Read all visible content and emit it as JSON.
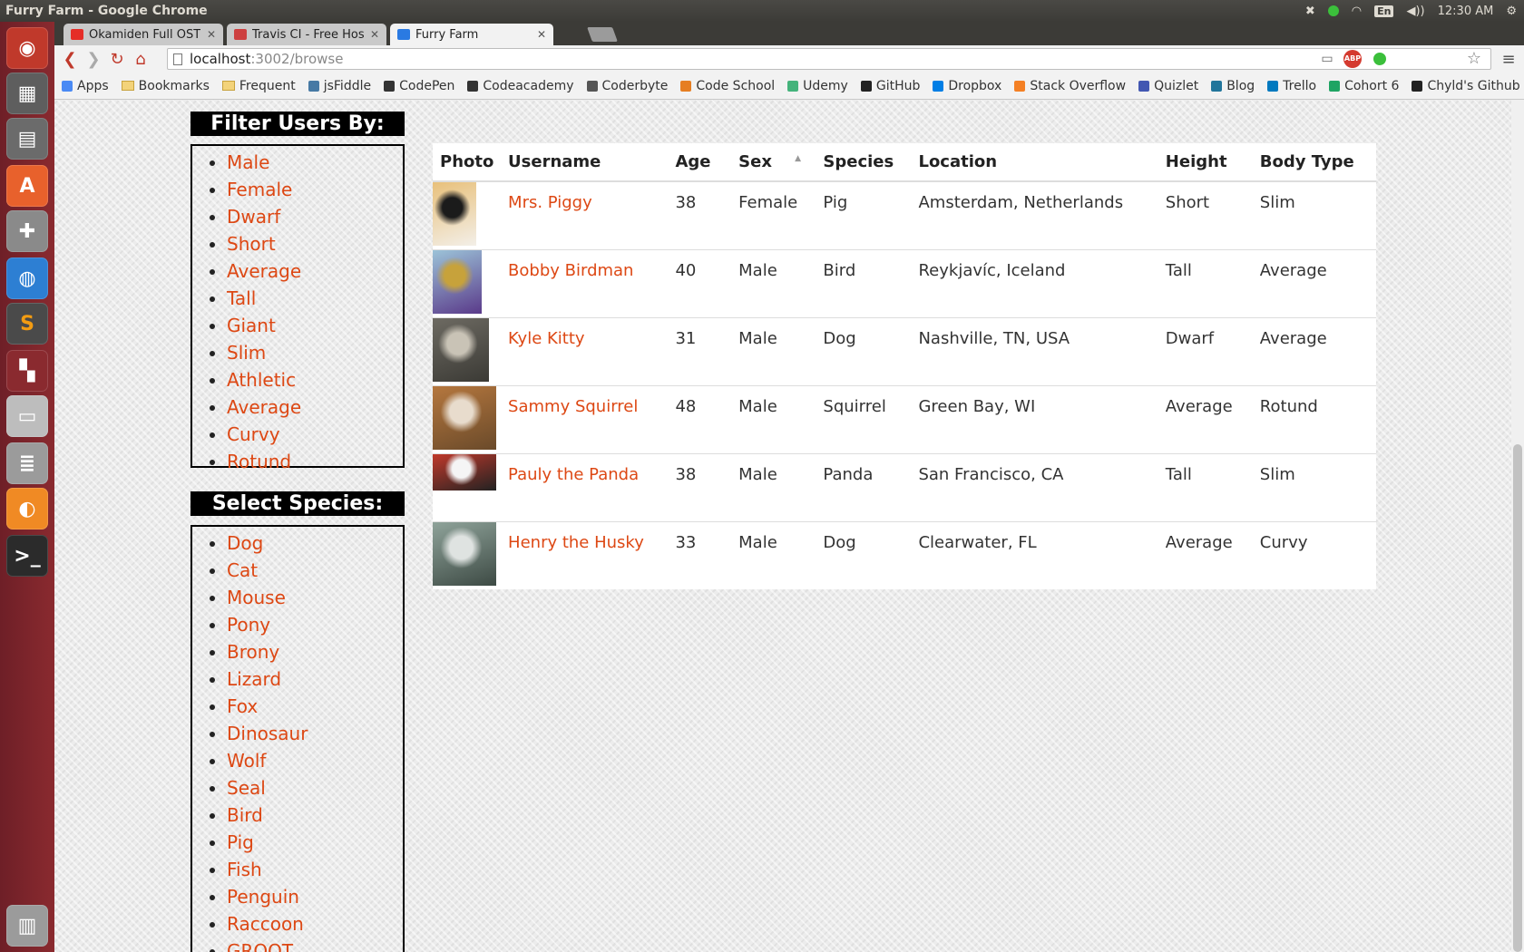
{
  "os": {
    "window_title": "Furry Farm - Google Chrome",
    "lang_indicator": "En",
    "clock": "12:30 AM"
  },
  "browser": {
    "tabs": [
      {
        "label": "Ōkamiden Full OST",
        "favicon_color": "#e52d27",
        "active": false
      },
      {
        "label": "Travis CI - Free Hosted",
        "favicon_color": "#cd3f3f",
        "active": false
      },
      {
        "label": "Furry Farm",
        "favicon_color": "#2a7ae2",
        "active": true
      }
    ],
    "url_host": "localhost",
    "url_path": ":3002/browse",
    "bookmarks": [
      {
        "label": "Apps",
        "icon": "apps-grid-icon",
        "color": "#4a8af4"
      },
      {
        "label": "Bookmarks",
        "icon": "folder-icon",
        "color": "#f3d37a"
      },
      {
        "label": "Frequent",
        "icon": "folder-icon",
        "color": "#f3d37a"
      },
      {
        "label": "jsFiddle",
        "icon": "jsfiddle-icon",
        "color": "#4679a4"
      },
      {
        "label": "CodePen",
        "icon": "codepen-icon",
        "color": "#333333"
      },
      {
        "label": "Codeacademy",
        "icon": "codeacademy-icon",
        "color": "#333333"
      },
      {
        "label": "Coderbyte",
        "icon": "coderbyte-icon",
        "color": "#555555"
      },
      {
        "label": "Code School",
        "icon": "codeschool-icon",
        "color": "#e67e22"
      },
      {
        "label": "Udemy",
        "icon": "udemy-icon",
        "color": "#44b37b"
      },
      {
        "label": "GitHub",
        "icon": "github-icon",
        "color": "#222222"
      },
      {
        "label": "Dropbox",
        "icon": "dropbox-icon",
        "color": "#007ee5"
      },
      {
        "label": "Stack Overflow",
        "icon": "stackoverflow-icon",
        "color": "#f48024"
      },
      {
        "label": "Quizlet",
        "icon": "quizlet-icon",
        "color": "#4257b2"
      },
      {
        "label": "Blog",
        "icon": "wordpress-icon",
        "color": "#21759b"
      },
      {
        "label": "Trello",
        "icon": "trello-icon",
        "color": "#0079bf"
      },
      {
        "label": "Cohort 6",
        "icon": "drive-icon",
        "color": "#1fa463"
      },
      {
        "label": "Chyld's Github",
        "icon": "github-icon",
        "color": "#222222"
      }
    ],
    "overflow_chevron": "»"
  },
  "filters": {
    "title": "Filter Users By:",
    "items": [
      "Male",
      "Female",
      "Dwarf",
      "Short",
      "Average",
      "Tall",
      "Giant",
      "Slim",
      "Athletic",
      "Average",
      "Curvy",
      "Rotund"
    ]
  },
  "species": {
    "title": "Select Species:",
    "items": [
      "Dog",
      "Cat",
      "Mouse",
      "Pony",
      "Brony",
      "Lizard",
      "Fox",
      "Dinosaur",
      "Wolf",
      "Seal",
      "Bird",
      "Pig",
      "Fish",
      "Penguin",
      "Raccoon",
      "GROOT"
    ]
  },
  "table": {
    "headers": [
      "Photo",
      "Username",
      "Age",
      "Sex",
      "Species",
      "Location",
      "Height",
      "Body Type"
    ],
    "sort_indicator": "▲",
    "rows": [
      {
        "username": "Mrs. Piggy",
        "age": "38",
        "sex": "Female",
        "species": "Pig",
        "location": "Amsterdam, Netherlands",
        "height": "Short",
        "body_type": "Slim",
        "photo_colors": [
          "#e8c07a",
          "#1b1b1b",
          "#f3efe8"
        ]
      },
      {
        "username": "Bobby Birdman",
        "age": "40",
        "sex": "Male",
        "species": "Bird",
        "location": "Reykjavíc, Iceland",
        "height": "Tall",
        "body_type": "Average",
        "photo_colors": [
          "#9cc3d8",
          "#c7a23b",
          "#5a3a8a"
        ]
      },
      {
        "username": "Kyle Kitty",
        "age": "31",
        "sex": "Male",
        "species": "Dog",
        "location": "Nashville, TN, USA",
        "height": "Dwarf",
        "body_type": "Average",
        "photo_colors": [
          "#6d6a62",
          "#c9c3b6",
          "#3b3a35"
        ]
      },
      {
        "username": "Sammy Squirrel",
        "age": "48",
        "sex": "Male",
        "species": "Squirrel",
        "location": "Green Bay, WI",
        "height": "Average",
        "body_type": "Rotund",
        "photo_colors": [
          "#b5773e",
          "#e8dccd",
          "#6a4a2a"
        ]
      },
      {
        "username": "Pauly the Panda",
        "age": "38",
        "sex": "Male",
        "species": "Panda",
        "location": "San Francisco, CA",
        "height": "Tall",
        "body_type": "Slim",
        "photo_colors": [
          "#c0392b",
          "#f5f5f5",
          "#222222"
        ]
      },
      {
        "username": "Henry the Husky",
        "age": "33",
        "sex": "Male",
        "species": "Dog",
        "location": "Clearwater, FL",
        "height": "Average",
        "body_type": "Curvy",
        "photo_colors": [
          "#8fa39a",
          "#dfe3e1",
          "#3d4a44"
        ]
      }
    ]
  },
  "colors": {
    "link": "#dd4814",
    "launcher_bg": "#8a2a2f",
    "panel_bar": "#3c3b37"
  }
}
